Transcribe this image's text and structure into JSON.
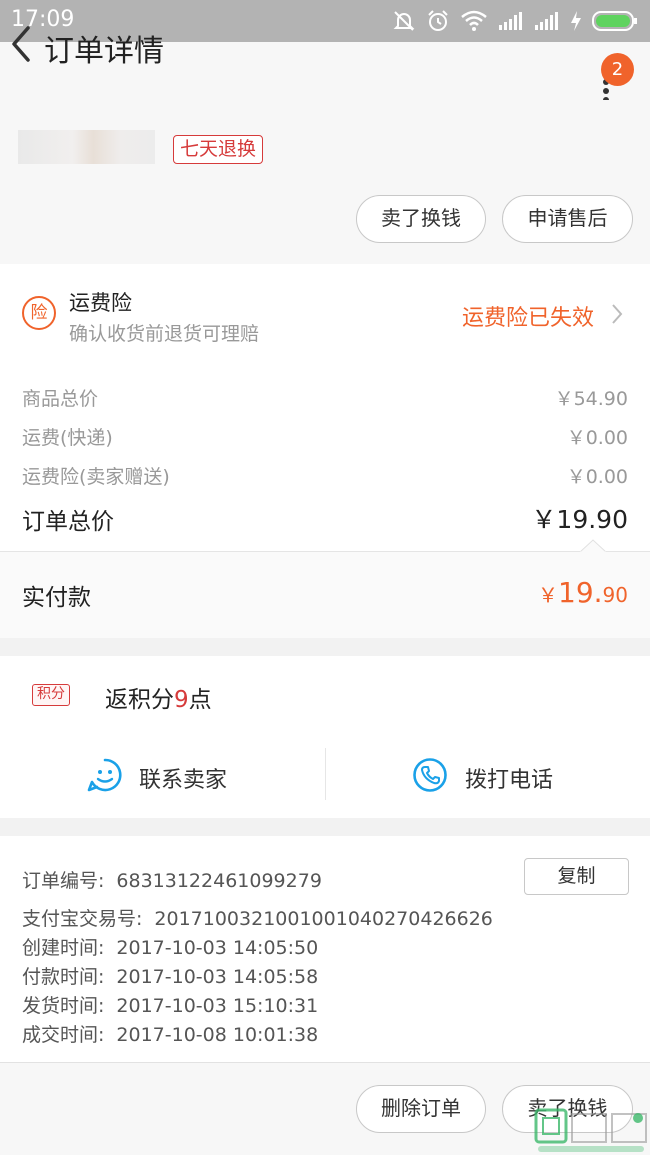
{
  "status_bar": {
    "time": "17:09",
    "icons": [
      "mute-bell-icon",
      "alarm-icon",
      "wifi-icon",
      "signal-icon",
      "signal-icon",
      "charging-icon",
      "battery-icon"
    ]
  },
  "header": {
    "title": "订单详情",
    "badge_count": "2",
    "icons": [
      "back-icon",
      "more-icon"
    ]
  },
  "product": {
    "tag": "七天退换",
    "buttons": {
      "sell": "卖了换钱",
      "after_sale": "申请售后"
    }
  },
  "insurance": {
    "icon_char": "险",
    "title": "运费险",
    "desc": "确认收货前退货可理赔",
    "status": "运费险已失效"
  },
  "price_rows": [
    {
      "label": "商品总价",
      "value": "￥54.90"
    },
    {
      "label": "运费(快递)",
      "value": "￥0.00"
    },
    {
      "label": "运费险(卖家赠送)",
      "value": "￥0.00"
    }
  ],
  "order_total": {
    "label": "订单总价",
    "value": "￥19.90"
  },
  "paid": {
    "label": "实付款",
    "currency": "￥",
    "integer": "19.",
    "decimal": "90"
  },
  "points": {
    "tag": "积分",
    "prefix": "返积分",
    "num": "9",
    "suffix": "点"
  },
  "contact": {
    "seller": "联系卖家",
    "call": "拨打电话"
  },
  "order_info": {
    "copy_label": "复制",
    "lines": [
      {
        "label": "订单编号:",
        "value": "68313122461099279"
      },
      {
        "label": "支付宝交易号:",
        "value": "2017100321001001040270426626"
      },
      {
        "label": "创建时间:",
        "value": "2017-10-03 14:05:50"
      },
      {
        "label": "付款时间:",
        "value": "2017-10-03 14:05:58"
      },
      {
        "label": "发货时间:",
        "value": "2017-10-03 15:10:31"
      },
      {
        "label": "成交时间:",
        "value": "2017-10-08 10:01:38"
      }
    ]
  },
  "footer": {
    "delete": "删除订单",
    "sell": "卖了换钱"
  },
  "colors": {
    "accent": "#f0632b",
    "red_tag": "#d63b3b",
    "blue_icon": "#1aa1e8"
  }
}
